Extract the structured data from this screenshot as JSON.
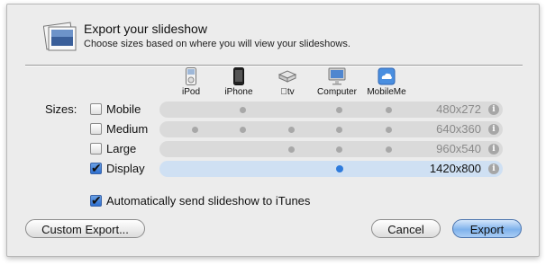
{
  "header": {
    "title": "Export your slideshow",
    "subtitle": "Choose sizes based on where you will view your slideshows."
  },
  "devices": [
    {
      "label": "iPod",
      "icon": "ipod-icon"
    },
    {
      "label": "iPhone",
      "icon": "iphone-icon"
    },
    {
      "label": "tv",
      "icon": "apple-tv-icon"
    },
    {
      "label": "Computer",
      "icon": "computer-icon"
    },
    {
      "label": "MobileMe",
      "icon": "mobileme-icon"
    }
  ],
  "sizes_label": "Sizes:",
  "rows": [
    {
      "label": "Mobile",
      "resolution": "480x272",
      "checked": false,
      "devices": [
        false,
        true,
        false,
        true,
        true
      ]
    },
    {
      "label": "Medium",
      "resolution": "640x360",
      "checked": false,
      "devices": [
        true,
        true,
        true,
        true,
        true
      ]
    },
    {
      "label": "Large",
      "resolution": "960x540",
      "checked": false,
      "devices": [
        false,
        false,
        true,
        true,
        true
      ]
    },
    {
      "label": "Display",
      "resolution": "1420x800",
      "checked": true,
      "devices": [
        false,
        false,
        false,
        true,
        false
      ]
    }
  ],
  "auto_send": {
    "label": "Automatically send slideshow to iTunes",
    "checked": true
  },
  "buttons": {
    "custom": "Custom Export...",
    "cancel": "Cancel",
    "export": "Export"
  },
  "colors": {
    "accent": "#2f7bdc",
    "selected_row": "#cfe0f3"
  }
}
